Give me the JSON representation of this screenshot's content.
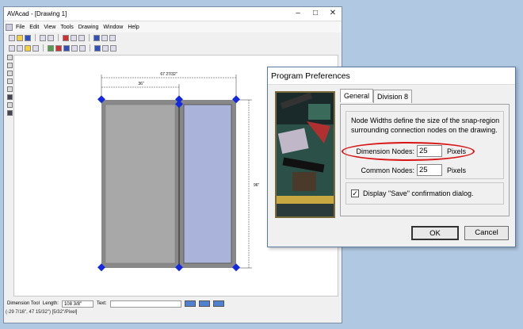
{
  "app": {
    "title": "AVAcad - [Drawing 1]",
    "menu": [
      "File",
      "Edit",
      "View",
      "Tools",
      "Drawing",
      "Window",
      "Help"
    ],
    "window_controls": {
      "minimize": "–",
      "maximize": "□",
      "close": "✕"
    }
  },
  "drawing": {
    "dim_overall": "67 27/32\"",
    "dim_left": "36\"",
    "dim_height": "96\"",
    "colors": {
      "panel_left": "#a8a8a8",
      "panel_right": "#aab4da",
      "frame": "#888888",
      "node": "#1428e0"
    }
  },
  "statusbar": {
    "tool": "Dimension Tool",
    "length_label": "Length:",
    "length_value": "108 3/8\"",
    "text_label": "Text:",
    "text_value": "",
    "coords": "(-29 7/16\", 47 15/32\") [5/32\"/Pixel]"
  },
  "dialog": {
    "title": "Program Preferences",
    "tabs": [
      "General",
      "Division 8"
    ],
    "active_tab": "General",
    "description": "Node Widths define the size of the snap-region surrounding connection nodes on the drawing.",
    "dimension_nodes": {
      "label": "Dimension Nodes:",
      "value": "25",
      "unit": "Pixels"
    },
    "common_nodes": {
      "label": "Common Nodes:",
      "value": "25",
      "unit": "Pixels"
    },
    "checkbox": {
      "label": "Display \"Save\" confirmation dialog.",
      "checked": true,
      "mark": "✓"
    },
    "ok_label": "OK",
    "cancel_label": "Cancel",
    "highlight_color": "#d81414"
  }
}
